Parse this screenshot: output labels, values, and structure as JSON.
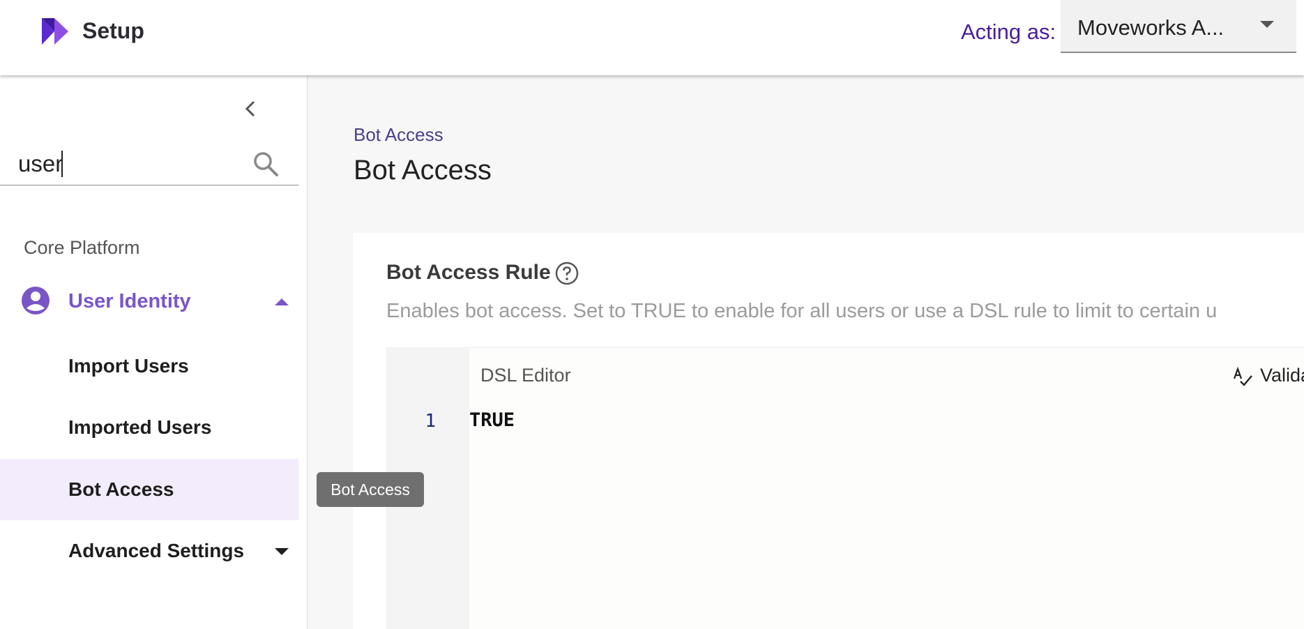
{
  "header": {
    "app_title": "Setup",
    "acting_as_label": "Acting as:",
    "acting_as_value": "Moveworks A..."
  },
  "sidebar": {
    "search": {
      "value": "user",
      "placeholder": ""
    },
    "section_label": "Core Platform",
    "parent_item": {
      "label": "User Identity",
      "icon": "user-circle-icon",
      "expanded": true
    },
    "items": [
      {
        "label": "Import Users",
        "active": false
      },
      {
        "label": "Imported Users",
        "active": false
      },
      {
        "label": "Bot Access",
        "active": true
      },
      {
        "label": "Advanced Settings",
        "active": false,
        "has_submenu": true
      }
    ]
  },
  "tooltip": {
    "text": "Bot Access"
  },
  "main": {
    "breadcrumb": "Bot Access",
    "title": "Bot Access",
    "rule": {
      "title": "Bot Access Rule",
      "description": "Enables bot access. Set to TRUE to enable for all users or use a DSL rule to limit to certain u",
      "editor": {
        "header": "DSL Editor",
        "validate_label": "Valida",
        "lines": [
          {
            "number": "1",
            "code": "TRUE"
          }
        ]
      }
    }
  },
  "colors": {
    "brand": "#6a2fd6",
    "accent_purple": "#7a55c7",
    "acting_label": "#4a1d96",
    "active_item_bg": "#f3ecfc"
  }
}
